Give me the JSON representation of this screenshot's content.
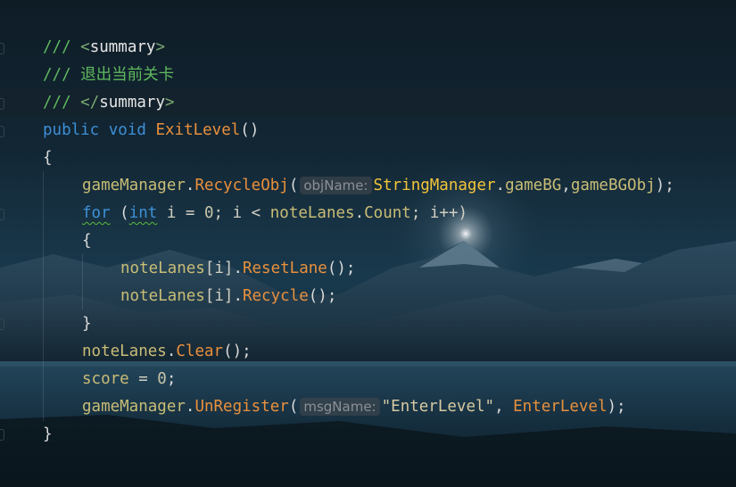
{
  "editor": {
    "background": "mountain-lake-night",
    "colors": {
      "comment": "#5fb95f",
      "keyword": "#3d8fd6",
      "method": "#e9903c",
      "identifier": "#c9bd76",
      "class": "#f3c43a",
      "hint": "#8c8f94"
    },
    "lines": [
      {
        "slash": "/// ",
        "open": "<",
        "tag": "summary",
        "close": ">"
      },
      {
        "slash": "/// ",
        "text": "退出当前关卡"
      },
      {
        "slash": "/// ",
        "open": "</",
        "tag": "summary",
        "close": ">"
      },
      {
        "kw1": "public",
        "kw2": "void",
        "name": "ExitLevel",
        "parens": "()"
      },
      {
        "brace": "{"
      },
      {
        "obj": "gameManager",
        "dot": ".",
        "method": "RecycleObj",
        "lparen": "(",
        "hint": "objName:",
        "cls": "StringManager",
        "dot2": ".",
        "arg1": "gameBG",
        "comma": ",",
        "arg2": "gameBGObj",
        "end": ");"
      },
      {
        "kw": "for",
        "lparen": " (",
        "type": "int",
        "init": " i = ",
        "zero": "0",
        "cond": "; i < ",
        "obj": "noteLanes",
        "dot": ".",
        "prop": "Count",
        "inc": "; i++)"
      },
      {
        "brace": "{"
      },
      {
        "obj": "noteLanes",
        "idx": "[i]",
        "dot": ".",
        "method": "ResetLane",
        "end": "();"
      },
      {
        "obj": "noteLanes",
        "idx": "[i]",
        "dot": ".",
        "method": "Recycle",
        "end": "();"
      },
      {
        "brace": "}"
      },
      {
        "obj": "noteLanes",
        "dot": ".",
        "method": "Clear",
        "end": "();"
      },
      {
        "obj": "score",
        "eq": " = ",
        "zero": "0",
        "end": ";"
      },
      {
        "obj": "gameManager",
        "dot": ".",
        "method": "UnRegister",
        "lparen": "(",
        "hint": "msgName:",
        "str": "\"EnterLevel\"",
        "comma": ", ",
        "arg": "EnterLevel",
        "end": ");"
      },
      {
        "brace": "}"
      }
    ]
  }
}
